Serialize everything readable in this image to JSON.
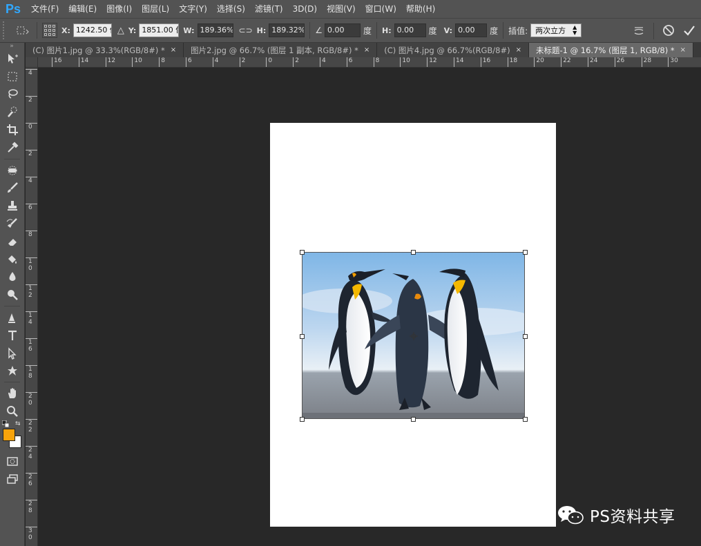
{
  "app": {
    "logo": "Ps",
    "accent": "#31a8ff"
  },
  "menu": [
    "文件(F)",
    "编辑(E)",
    "图像(I)",
    "图层(L)",
    "文字(Y)",
    "选择(S)",
    "滤镜(T)",
    "3D(D)",
    "视图(V)",
    "窗口(W)",
    "帮助(H)"
  ],
  "options": {
    "x_label": "X:",
    "x_value": "1242.50 像",
    "y_label": "Y:",
    "y_value": "1851.00 像",
    "w_label": "W:",
    "w_value": "189.36%",
    "h_label": "H:",
    "h_value": "189.32%",
    "angle_value": "0.00",
    "degree": "度",
    "hskew_label": "H:",
    "hskew_value": "0.00",
    "vskew_label": "V:",
    "vskew_value": "0.00",
    "interp_label": "插值:",
    "interp_value": "两次立方"
  },
  "tabs": [
    {
      "label": "(C) 图片1.jpg @ 33.3%(RGB/8#) *",
      "close": "×"
    },
    {
      "label": "图片2.jpg @ 66.7% (图层 1 副本, RGB/8#) *",
      "close": "×"
    },
    {
      "label": "(C) 图片4.jpg @ 66.7%(RGB/8#)",
      "close": "×"
    },
    {
      "label": "未标题-1 @ 16.7% (图层 1, RGB/8) *",
      "close": "×"
    }
  ],
  "ruler_h": [
    "16",
    "14",
    "12",
    "10",
    "8",
    "6",
    "4",
    "2",
    "0",
    "2",
    "4",
    "6",
    "8",
    "10",
    "12",
    "14",
    "16",
    "18",
    "20",
    "22",
    "24",
    "26",
    "28",
    "30"
  ],
  "ruler_v": [
    "4",
    "2",
    "0",
    "2",
    "4",
    "6",
    "8",
    "1\n0",
    "1\n2",
    "1\n4",
    "1\n6",
    "1\n8",
    "2\n0",
    "2\n2",
    "2\n4",
    "2\n6",
    "2\n8",
    "3\n0"
  ],
  "colors": {
    "foreground": "#f7a30b",
    "background": "#ffffff"
  },
  "watermark": "PS资料共享"
}
